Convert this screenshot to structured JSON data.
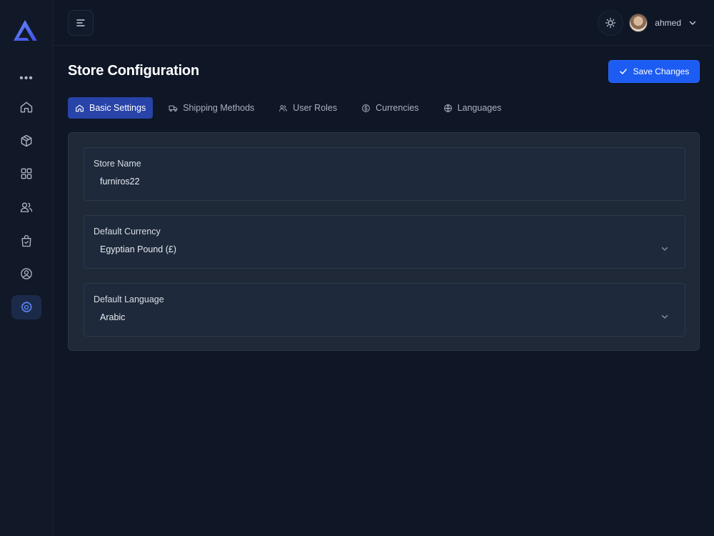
{
  "header": {
    "user_name": "ahmed"
  },
  "page": {
    "title": "Store Configuration",
    "save_label": "Save Changes"
  },
  "tabs": [
    {
      "label": "Basic Settings",
      "icon": "home-icon",
      "active": true
    },
    {
      "label": "Shipping Methods",
      "icon": "truck-icon",
      "active": false
    },
    {
      "label": "User Roles",
      "icon": "users-icon",
      "active": false
    },
    {
      "label": "Currencies",
      "icon": "dollar-icon",
      "active": false
    },
    {
      "label": "Languages",
      "icon": "globe-icon",
      "active": false
    }
  ],
  "sidebar": {
    "items": [
      {
        "icon": "more-icon"
      },
      {
        "icon": "home-icon"
      },
      {
        "icon": "package-icon"
      },
      {
        "icon": "grid-icon"
      },
      {
        "icon": "users-icon"
      },
      {
        "icon": "shopping-bag-icon"
      },
      {
        "icon": "user-circle-icon"
      },
      {
        "icon": "settings-icon",
        "active": true
      }
    ]
  },
  "form": {
    "store_name": {
      "label": "Store Name",
      "value": "furniros22"
    },
    "default_currency": {
      "label": "Default Currency",
      "value": "Egyptian Pound (£)"
    },
    "default_language": {
      "label": "Default Language",
      "value": "Arabic"
    }
  },
  "colors": {
    "background": "#0f1626",
    "accent": "#1d5cf2",
    "active_tab": "#2844a8",
    "panel": "#1f2937"
  }
}
